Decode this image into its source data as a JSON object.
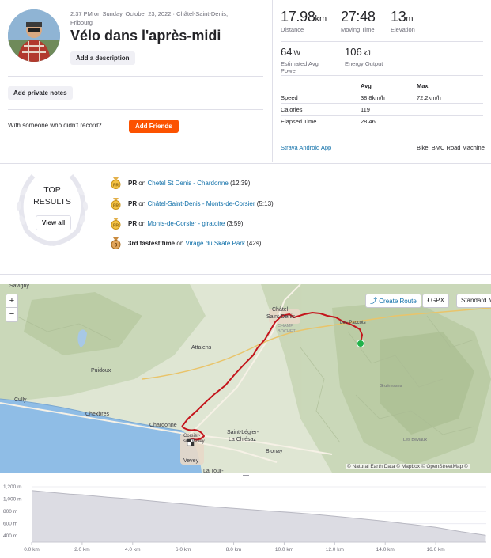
{
  "header": {
    "meta_line1": "2:37 PM on Sunday, October 23, 2022 · Châtel-Saint-Denis,",
    "meta_line2": "Fribourg",
    "title": "Vélo dans l'après-midi",
    "add_description": "Add a description",
    "add_private_notes": "Add private notes",
    "with_someone": "With someone who didn't record?",
    "add_friends": "Add Friends"
  },
  "stats": {
    "distance_value": "17.98",
    "distance_unit": "km",
    "distance_label": "Distance",
    "moving_value": "27:48",
    "moving_label": "Moving Time",
    "elevation_value": "13",
    "elevation_unit": "m",
    "elevation_label": "Elevation",
    "power_value": "64",
    "power_unit": "W",
    "power_label_1": "Estimated Avg",
    "power_label_2": "Power",
    "energy_value": "106",
    "energy_unit": "kJ",
    "energy_label": "Energy Output"
  },
  "table": {
    "col_avg": "Avg",
    "col_max": "Max",
    "rows": [
      {
        "label": "Speed",
        "avg": "38.8km/h",
        "max": "72.2km/h"
      },
      {
        "label": "Calories",
        "avg": "119",
        "max": ""
      },
      {
        "label": "Elapsed Time",
        "avg": "28:46",
        "max": ""
      }
    ]
  },
  "device": "Strava Android App",
  "bike_label": "Bike:",
  "bike_value": "BMC Road Machine",
  "top_results": {
    "line1": "TOP",
    "line2": "RESULTS",
    "view_all": "View all"
  },
  "achievements": [
    {
      "prefix": "PR",
      "on": "on",
      "segment": "Chetel St Denis - Chardonne",
      "suffix": "(12:39)",
      "medal": "gold"
    },
    {
      "prefix": "PR",
      "on": "on",
      "segment": "Châtel-Saint-Denis - Monts-de-Corsier",
      "suffix": "(5:13)",
      "medal": "gold"
    },
    {
      "prefix": "PR",
      "on": "on",
      "segment": "Monts-de-Corsier - giratoire",
      "suffix": "(3:59)",
      "medal": "gold"
    },
    {
      "prefix": "3rd fastest time",
      "on": "on",
      "segment": "Virage du Skate Park",
      "suffix": "(42s)",
      "medal": "bronze"
    }
  ],
  "map": {
    "zoom_in": "+",
    "zoom_out": "−",
    "create_route": "Create Route",
    "gpx": "GPX",
    "standard": "Standard M",
    "attribution": "© Natural Earth Data © Mapbox © OpenStreetMap ©",
    "labels": [
      "Savigny",
      "Châtel-",
      "Saint-Denis",
      "CHAMP",
      "BOCHET",
      "Les Paccots",
      "Attalens",
      "Puidoux",
      "Chexbres",
      "Cully",
      "Chardonne",
      "Corsier-sur-Vevey",
      "Saint-Légier-",
      "La Chiésaz",
      "Blonay",
      "Vevey",
      "La Tour-",
      "Gruéresses",
      "Les Béviaux"
    ]
  },
  "chart_data": {
    "type": "area",
    "ylabels": [
      "1,200 m",
      "1,000 m",
      "800 m",
      "600 m",
      "400 m"
    ],
    "xlabels": [
      "0.0 km",
      "2.0 km",
      "4.0 km",
      "6.0 km",
      "8.0 km",
      "10.0 km",
      "12.0 km",
      "14.0 km",
      "16.0 km"
    ],
    "ylim": [
      300,
      1200
    ],
    "xlim": [
      0,
      18
    ],
    "x": [
      0,
      0.5,
      1,
      1.5,
      2,
      2.5,
      3,
      3.5,
      4,
      5,
      6,
      7,
      8,
      9,
      10,
      11,
      12,
      13,
      14,
      15,
      16,
      17,
      17.98
    ],
    "y": [
      1140,
      1120,
      1100,
      1080,
      1070,
      1050,
      1030,
      1015,
      1000,
      960,
      920,
      880,
      850,
      820,
      790,
      760,
      720,
      680,
      640,
      590,
      540,
      470,
      410
    ]
  }
}
